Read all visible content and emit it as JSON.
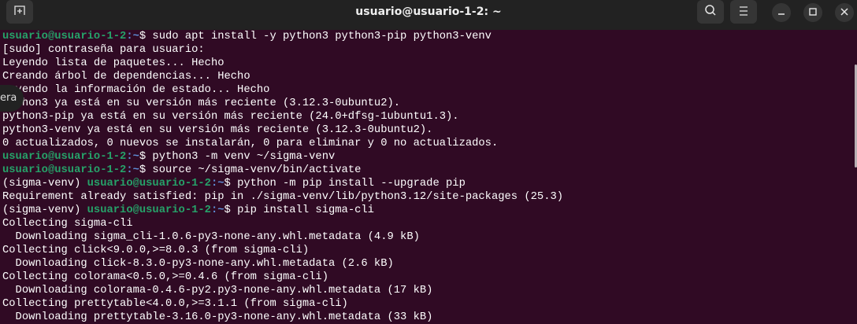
{
  "window": {
    "title": "usuario@usuario-1-2: ~",
    "new_tab_icon": "new-tab-icon",
    "search_icon": "search-icon",
    "menu_icon": "hamburger-menu-icon"
  },
  "tooltip": {
    "text": "era"
  },
  "terminal": {
    "lines": [
      {
        "env": "",
        "user": "usuario@usuario-1-2",
        "path": ":~",
        "cmd": "$ sudo apt install -y python3 python3-pip python3-venv"
      },
      {
        "text": "[sudo] contraseña para usuario:"
      },
      {
        "text": "Leyendo lista de paquetes... Hecho"
      },
      {
        "text": "Creando árbol de dependencias... Hecho"
      },
      {
        "text": "Leyendo la información de estado... Hecho"
      },
      {
        "text": "python3 ya está en su versión más reciente (3.12.3-0ubuntu2)."
      },
      {
        "text": "python3-pip ya está en su versión más reciente (24.0+dfsg-1ubuntu1.3)."
      },
      {
        "text": "python3-venv ya está en su versión más reciente (3.12.3-0ubuntu2)."
      },
      {
        "text": "0 actualizados, 0 nuevos se instalarán, 0 para eliminar y 0 no actualizados."
      },
      {
        "env": "",
        "user": "usuario@usuario-1-2",
        "path": ":~",
        "cmd": "$ python3 -m venv ~/sigma-venv"
      },
      {
        "env": "",
        "user": "usuario@usuario-1-2",
        "path": ":~",
        "cmd": "$ source ~/sigma-venv/bin/activate"
      },
      {
        "env": "(sigma-venv) ",
        "user": "usuario@usuario-1-2",
        "path": ":~",
        "cmd": "$ python -m pip install --upgrade pip"
      },
      {
        "text": "Requirement already satisfied: pip in ./sigma-venv/lib/python3.12/site-packages (25.3)"
      },
      {
        "env": "(sigma-venv) ",
        "user": "usuario@usuario-1-2",
        "path": ":~",
        "cmd": "$ pip install sigma-cli"
      },
      {
        "text": "Collecting sigma-cli"
      },
      {
        "text": "  Downloading sigma_cli-1.0.6-py3-none-any.whl.metadata (4.9 kB)"
      },
      {
        "text": "Collecting click<9.0.0,>=8.0.3 (from sigma-cli)"
      },
      {
        "text": "  Downloading click-8.3.0-py3-none-any.whl.metadata (2.6 kB)"
      },
      {
        "text": "Collecting colorama<0.5.0,>=0.4.6 (from sigma-cli)"
      },
      {
        "text": "  Downloading colorama-0.4.6-py2.py3-none-any.whl.metadata (17 kB)"
      },
      {
        "text": "Collecting prettytable<4.0.0,>=3.1.1 (from sigma-cli)"
      },
      {
        "text": "  Downloading prettytable-3.16.0-py3-none-any.whl.metadata (33 kB)"
      }
    ]
  }
}
